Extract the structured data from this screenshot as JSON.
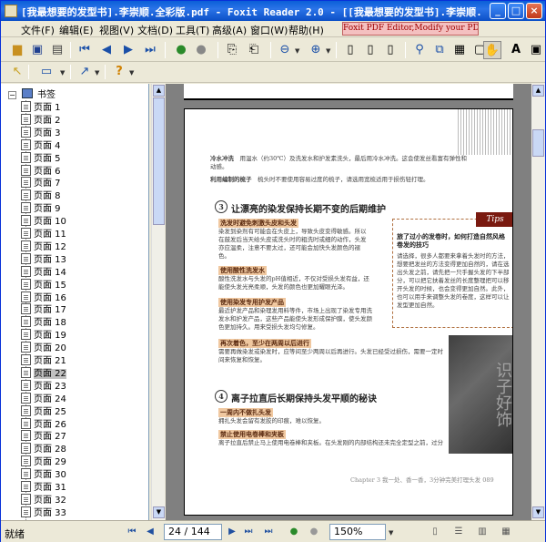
{
  "window": {
    "title": "[我最想要的发型书].李崇顺.全彩版.pdf - Foxit Reader 2.0 - [[我最想要的发型书].李崇顺.全...",
    "min": "_",
    "max": "□",
    "close": "×"
  },
  "menu": {
    "items": [
      "文件(F)",
      "编辑(E)",
      "视图(V)",
      "文档(D)",
      "工具(T)",
      "高级(A)",
      "窗口(W)",
      "帮助(H)"
    ],
    "promo": "Foxit PDF Editor,Modify your PDF!"
  },
  "sidebar": {
    "root": "书签",
    "pages": [
      "页面 1",
      "页面 2",
      "页面 3",
      "页面 4",
      "页面 5",
      "页面 6",
      "页面 7",
      "页面 8",
      "页面 9",
      "页面 10",
      "页面 11",
      "页面 12",
      "页面 13",
      "页面 14",
      "页面 15",
      "页面 16",
      "页面 17",
      "页面 18",
      "页面 19",
      "页面 20",
      "页面 21",
      "页面 22",
      "页面 23",
      "页面 24",
      "页面 25",
      "页面 26",
      "页面 27",
      "页面 28",
      "页面 29",
      "页面 30",
      "页面 31",
      "页面 32",
      "页面 33"
    ],
    "selected_index": 21
  },
  "page": {
    "para1_title": "冷水冲洗",
    "para1": "用温水（约30℃）及洗发水和护发素洗头，最后用冷水冲洗。这会使发丝看富有弹性和动感。",
    "para2_title": "利用编制的梳子",
    "para2": "梳头时不要使用容易过度的梳子，请选用宽梳适用于损伤轻打理。",
    "section3_num": "3",
    "section3_title": "让漂亮的染发保持长期不变的后期维护",
    "h_a": "洗发时避免刺激头皮和头发",
    "text_a": "染发到染剂有可能会在头皮上，导致头皮变得敏感。所以在鼓发后当天给头皮或洗头时的粗洗时或细的动作，头发亦应温柔，注意不要太过，还可能会加快头发颜色的褪色。",
    "h_b": "使用酸性洗发水",
    "text_b": "酸性洗发水与头发的pH值相近，不仅对受损头发有益，还能使头发光亮柔顺，头发的颜色也更加耀眼光泽。",
    "h_c": "使用染发专用护发产品",
    "text_c": "最近护发产品和染理发用料等件，市场上出现了染发专用洗发水和护发产品，这些产品能使头发形成保护膜，使头发颜色更加持久。用来受损头发均匀修复。",
    "h_d": "再次着色，至少在两周以后进行",
    "text_d": "需要再做染发或染发时，应等间至少两周以后再进行。头发已经受过损伤，需要一定时间来恢复和恢复。",
    "section4_num": "4",
    "section4_title": "离子拉直后长期保持头发平顺的秘诀",
    "h_e": "一周内不做扎头发",
    "text_e": "拥扎头发会留有发胶的印痕，难以恢复。",
    "h_f": "禁止使用电卷棒和夹板",
    "text_f": "离子拉直后禁止马上使用电卷棒和夹板。在头发刚的内部结构还未完全定型之前，过分",
    "footer": "Chapter 3  我一处、香一香，3分钟完美打理头发  089",
    "tips_tag": "Tips",
    "tips_title": "旅了过小的发卷时，如何打造自然风格卷发的技巧",
    "tips_text": "请选择，很多人都要来拿着头发时的方法，想要把发丝的方法变得更加自然的，请在选出头发之前，请先把一只手握头发的下半部分，可以把它扶着发丝的长度整理把可以移开头发的时候，也会变得更加自然。此外，也可以用手来调整头发的卷度，这样可以让发型更加自然。",
    "photo_text": "识子好饰"
  },
  "status": {
    "text": "就绪",
    "page_box": "24 / 144",
    "zoom": "150%"
  }
}
